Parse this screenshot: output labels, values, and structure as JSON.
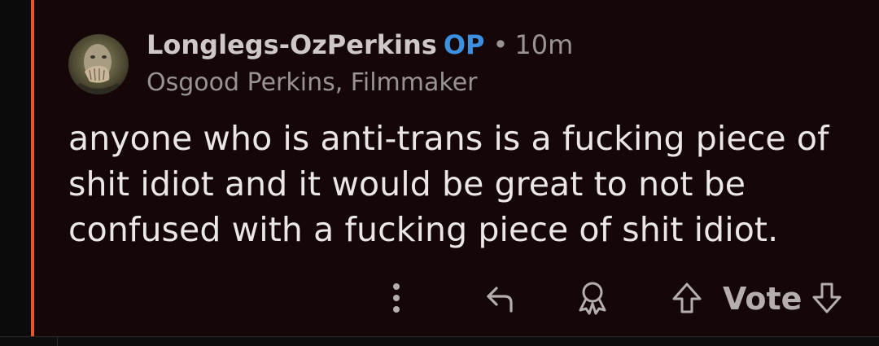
{
  "comment": {
    "username": "Longlegs-OzPerkins",
    "op_badge": "OP",
    "separator": "•",
    "timestamp": "10m",
    "flair": "Osgood Perkins, Filmmaker",
    "body": "anyone who is anti-trans is a fucking piece of shit idiot and it would be great to not be confused with a fucking piece of shit idiot.",
    "avatar_icon": "user-avatar"
  },
  "actions": {
    "more_icon": "more-vertical-icon",
    "reply_icon": "reply-icon",
    "award_icon": "award-icon",
    "upvote_icon": "upvote-arrow-icon",
    "vote_label": "Vote",
    "downvote_icon": "downvote-arrow-icon"
  },
  "colors": {
    "background": "#150707",
    "thread_line": "#e8532a",
    "op_badge": "#3d8fe0",
    "username": "#cfc8c8",
    "secondary_text": "#9a9393",
    "body_text": "#ece7e7",
    "icon": "#b4aeae"
  }
}
